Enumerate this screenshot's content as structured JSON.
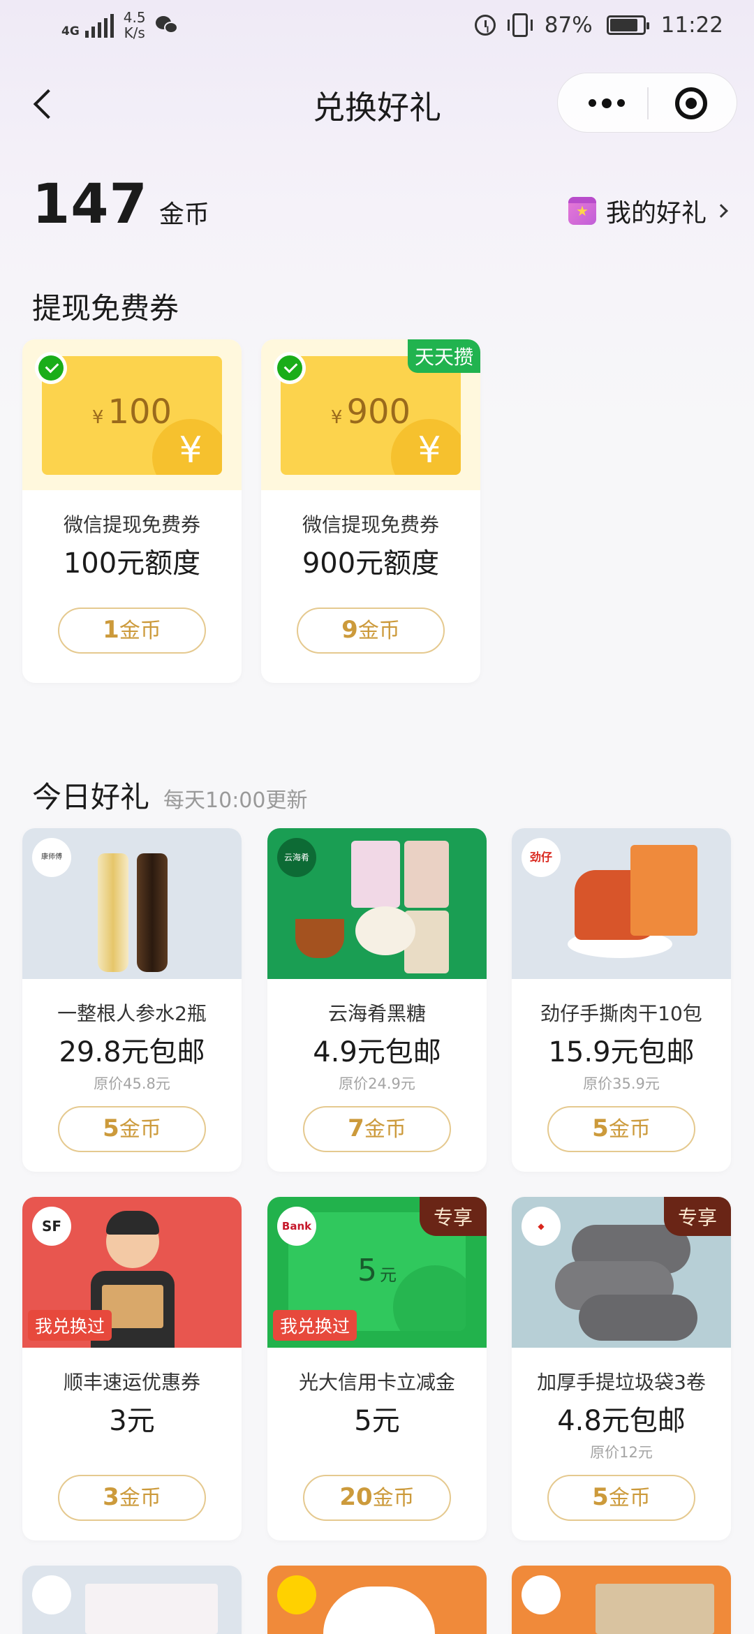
{
  "status_bar": {
    "network": "4G",
    "speed_value": "4.5",
    "speed_unit": "K/s",
    "battery": "87%",
    "battery_level": 0.87,
    "time": "11:22"
  },
  "nav": {
    "title": "兑换好礼"
  },
  "balance": {
    "value": "147",
    "unit": "金币",
    "my_gifts_label": "我的好礼"
  },
  "withdraw_section": {
    "title": "提现免费券",
    "items": [
      {
        "voucher_currency": "¥",
        "voucher_amount": "100",
        "name": "微信提现免费券",
        "price": "100元额度",
        "coins": "1",
        "coin_unit": "金币",
        "tag": ""
      },
      {
        "voucher_currency": "¥",
        "voucher_amount": "900",
        "name": "微信提现免费券",
        "price": "900元额度",
        "coins": "9",
        "coin_unit": "金币",
        "tag": "天天攒"
      }
    ]
  },
  "daily_section": {
    "title": "今日好礼",
    "subtitle": "每天10:00更新",
    "items": [
      {
        "name": "一整根人参水2瓶",
        "price": "29.8元包邮",
        "original": "原价45.8元",
        "coins": "5",
        "coin_unit": "金币",
        "image_bg": "#dde4ec"
      },
      {
        "name": "云海肴黑糖",
        "price": "4.9元包邮",
        "original": "原价24.9元",
        "coins": "7",
        "coin_unit": "金币",
        "image_bg": "#1a9e53",
        "logo_text": "云海肴"
      },
      {
        "name": "劲仔手撕肉干10包",
        "price": "15.9元包邮",
        "original": "原价35.9元",
        "coins": "5",
        "coin_unit": "金币",
        "image_bg": "#dde4ec",
        "logo_text": "劲仔"
      },
      {
        "name": "顺丰速运优惠券",
        "price": "3元",
        "original": "",
        "coins": "3",
        "coin_unit": "金币",
        "image_bg": "#e8564f",
        "logo_text": "SF",
        "tag_left": "我兑换过"
      },
      {
        "name": "光大信用卡立减金",
        "price": "5元",
        "original": "",
        "coins": "20",
        "coin_unit": "金币",
        "image_bg": "#22b24c",
        "logo_text": "Bank",
        "tag_left": "我兑换过",
        "tag_right": "专享",
        "card_amount": "5",
        "card_unit": "元"
      },
      {
        "name": "加厚手提垃圾袋3卷",
        "price": "4.8元包邮",
        "original": "原价12元",
        "coins": "5",
        "coin_unit": "金币",
        "image_bg": "#b7cfd6",
        "tag_right": "专享"
      }
    ]
  }
}
